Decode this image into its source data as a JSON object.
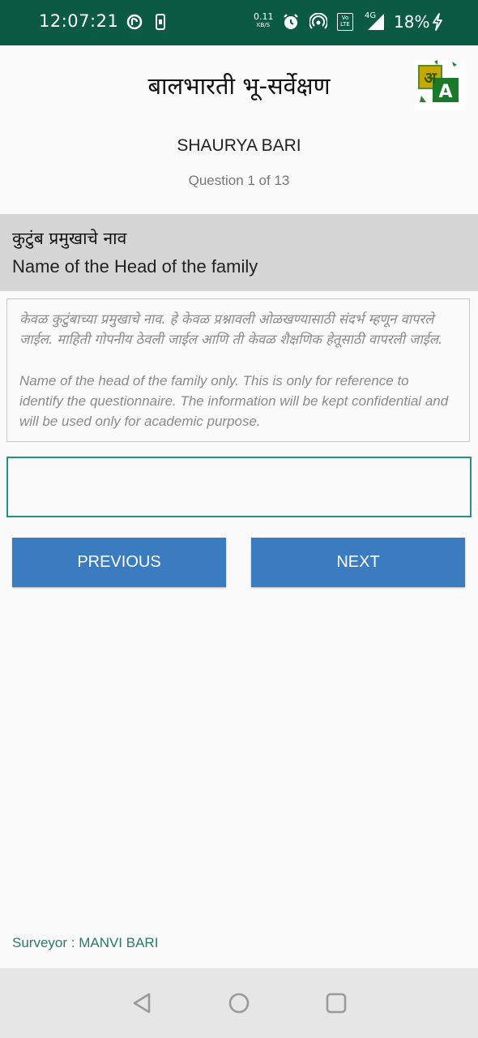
{
  "status_bar": {
    "time": "12:07:21",
    "net_speed_value": "0.11",
    "net_speed_unit": "KB/S",
    "volte_label": "Vo LTE",
    "network_type": "4G",
    "battery": "18%",
    "icons": [
      "sync-icon",
      "phone-icon",
      "net-speed-icon",
      "alarm-icon",
      "hotspot-icon",
      "volte-icon",
      "signal-icon",
      "battery-charging-icon"
    ]
  },
  "app": {
    "title": "बालभारती भू-सर्वेक्षण",
    "lang_icon": {
      "letter_mr": "अ",
      "letter_en": "A"
    },
    "user_name": "SHAURYA BARI",
    "progress": "Question 1 of 13"
  },
  "question": {
    "label_mr": "कुटुंब प्रमुखाचे नाव",
    "label_en": "Name of the Head of the family",
    "hint_mr": "केवळ कुटुंबाच्या प्रमुखाचे नाव. हे केवळ प्रश्नावली ओळखण्यासाठी संदर्भ म्हणून वापरले जाईल. माहिती गोपनीय ठेवली जाईल आणि ती केवळ शैक्षणिक हेतूसाठी वापरली जाईल.",
    "hint_en": "Name of the head of the family only.  This is only for reference to identify the questionnaire. The information will be kept confidential and will be used only for academic purpose.",
    "answer_value": ""
  },
  "buttons": {
    "previous": "PREVIOUS",
    "next": "NEXT"
  },
  "footer": {
    "surveyor": "Surveyor : MANVI BARI"
  },
  "colors": {
    "status_bar": "#0b5a44",
    "header_bg": "#d6d6d6",
    "button_bg": "#3b7bbf",
    "input_border": "#2a8f86",
    "surveyor_text": "#2a7a66"
  }
}
